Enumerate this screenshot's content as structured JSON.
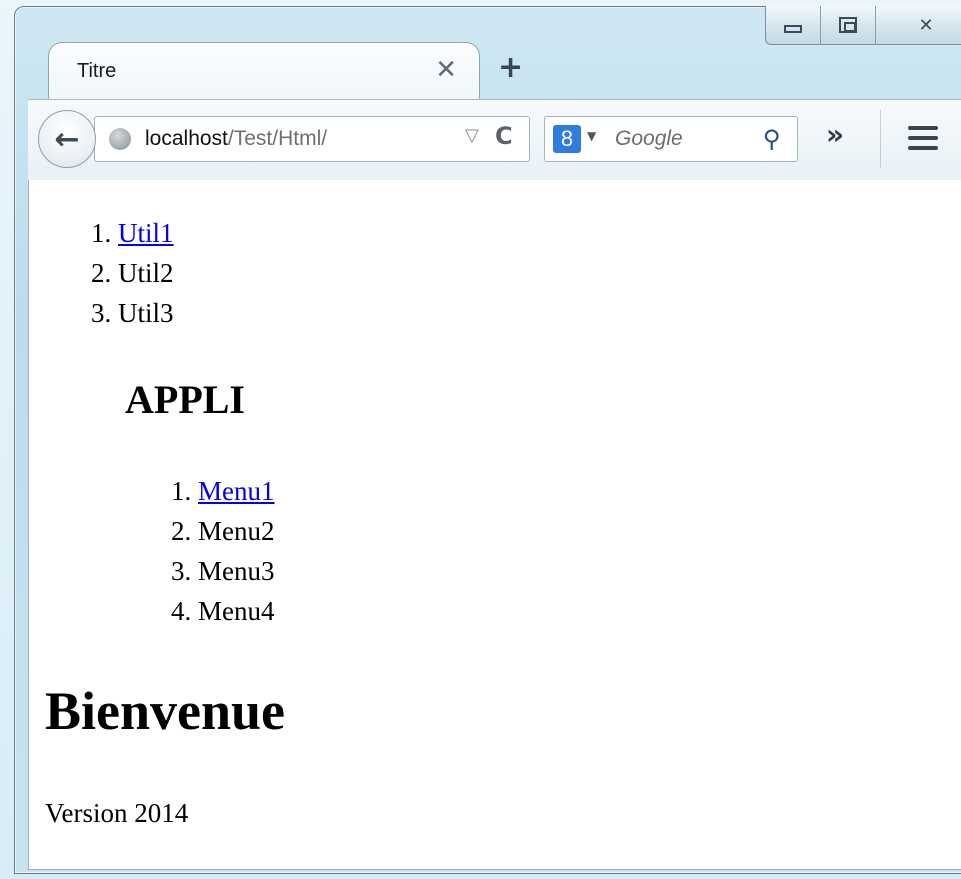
{
  "browser": {
    "tab_title": "Titre",
    "tab_close_glyph": "✕",
    "new_tab_glyph": "+",
    "url_host": "localhost",
    "url_path": "/Test/Html/",
    "search_engine_letter": "8",
    "search_placeholder": "Google",
    "overflow_glyph": "»",
    "back_glyph": "←",
    "reload_glyph": "C",
    "dropdown_glyph": "▽",
    "caption_close_glyph": "✕"
  },
  "page": {
    "util_list": [
      {
        "num": "1.",
        "label": "Util1",
        "link": true
      },
      {
        "num": "2.",
        "label": "Util2",
        "link": false
      },
      {
        "num": "3.",
        "label": "Util3",
        "link": false
      }
    ],
    "appli_heading": "APPLI",
    "menu_list": [
      {
        "num": "1.",
        "label": "Menu1",
        "link": true
      },
      {
        "num": "2.",
        "label": "Menu2",
        "link": false
      },
      {
        "num": "3.",
        "label": "Menu3",
        "link": false
      },
      {
        "num": "4.",
        "label": "Menu4",
        "link": false
      }
    ],
    "main_heading": "Bienvenue",
    "version_text": "Version 2014"
  },
  "colors": {
    "link": "#0000ee",
    "search_engine_badge": "#2f7be0",
    "text": "#000000"
  }
}
